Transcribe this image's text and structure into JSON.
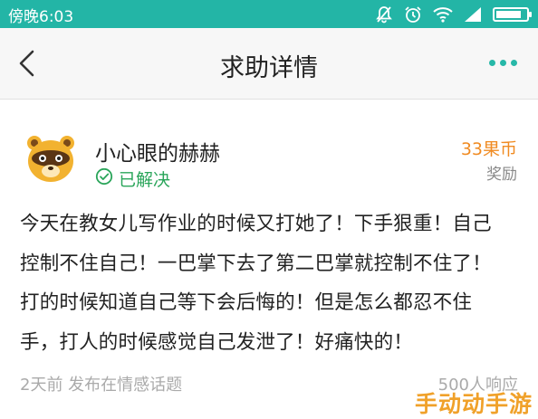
{
  "status_bar": {
    "time": "傍晚6:03",
    "icons": [
      "mute-icon",
      "alarm-icon",
      "wifi-icon",
      "signal-icon",
      "battery-icon"
    ],
    "battery_level": 0.85
  },
  "nav": {
    "title": "求助详情",
    "back_icon": "chevron-left-icon",
    "more_icon": "more-dots-icon",
    "accent": "#27b8a8"
  },
  "post": {
    "username": "小心眼的赫赫",
    "status": "已解决",
    "reward_amount": "33果币",
    "reward_label": "奖励",
    "content_lines": [
      "今天在教女儿写作业的时候又打她了！下手狠重！自己",
      "控制不住自己！一巴掌下去了第二巴掌就控制不住了！",
      "打的时候知道自己等下会后悔的！但是怎么都忍不住",
      "手，打人的时候感觉自己发泄了！好痛快的！"
    ],
    "meta": "2天前 发布在情感话题",
    "views": "500人响应"
  },
  "watermark": "手动动手游",
  "colors": {
    "status_bar": "#23b5a6",
    "solved": "#2aa55a",
    "reward": "#f08b22",
    "muted": "#aaaaaa"
  }
}
